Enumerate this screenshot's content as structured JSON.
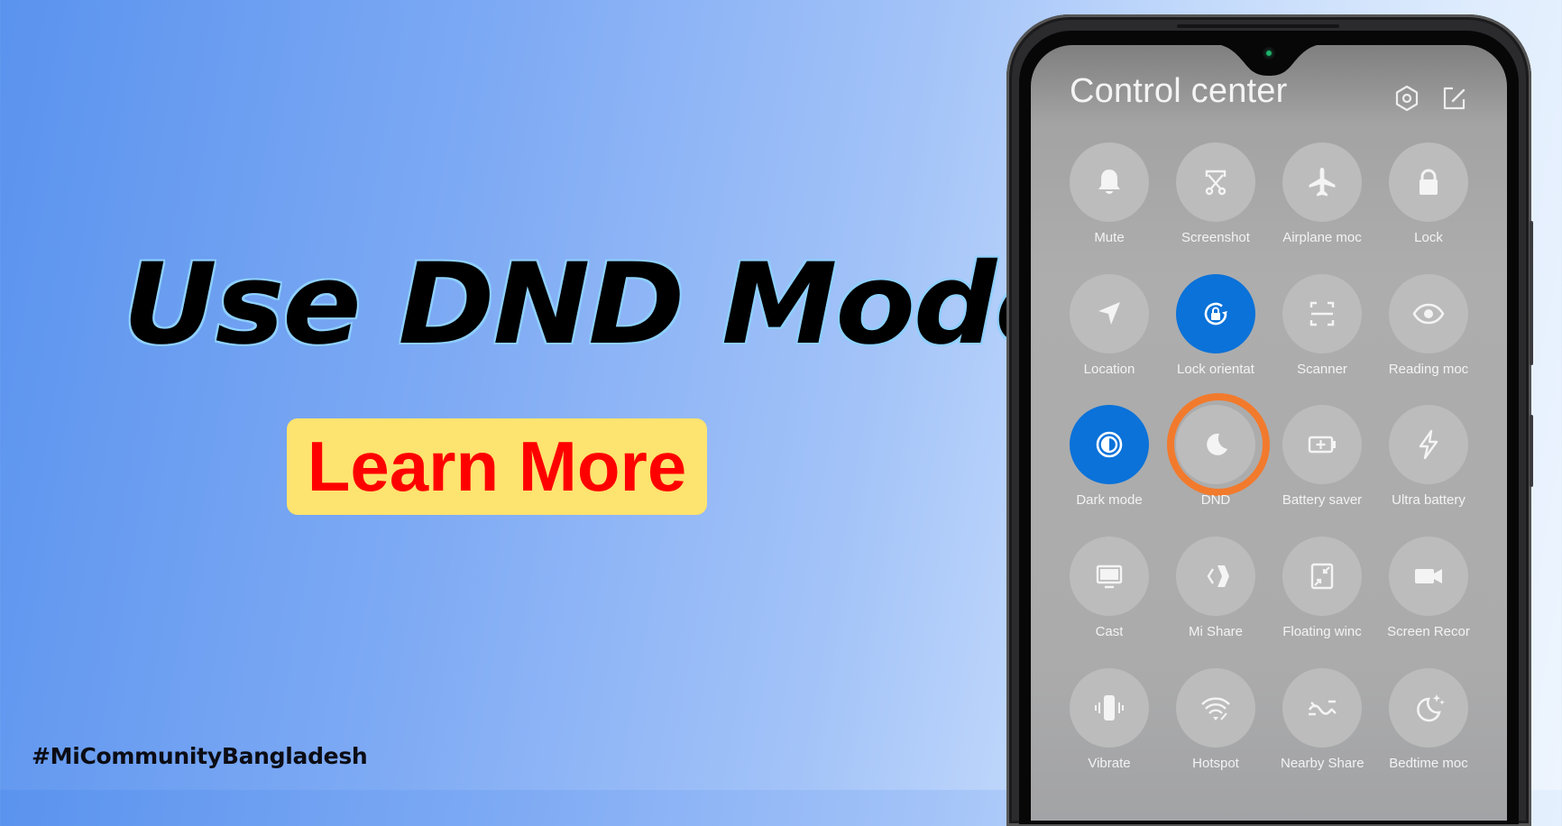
{
  "headline": "Use DND Mode",
  "cta_label": "Learn More",
  "hashtag": "#MiCommunityBangladesh",
  "colors": {
    "headline_text": "#000000",
    "headline_outline": "#8fd0ff",
    "cta_background": "#fde36f",
    "cta_text": "#ff0000",
    "tile_active": "#0a72d9",
    "highlight_ring": "#f27a2c"
  },
  "phone": {
    "control_center": {
      "title": "Control center",
      "header_icons": [
        {
          "name": "settings-icon"
        },
        {
          "name": "edit-icon"
        }
      ],
      "tiles": [
        {
          "label": "Mute",
          "icon": "bell-icon",
          "active": false
        },
        {
          "label": "Screenshot",
          "icon": "screenshot-scissors-icon",
          "active": false
        },
        {
          "label": "Airplane mode",
          "label_visible": "Airplane moc",
          "icon": "airplane-icon",
          "active": false
        },
        {
          "label": "Lock",
          "icon": "lock-icon",
          "active": false
        },
        {
          "label": "Location",
          "icon": "location-arrow-icon",
          "active": false
        },
        {
          "label": "Lock orientation",
          "label_visible": "Lock orientat",
          "icon": "rotation-lock-icon",
          "active": true
        },
        {
          "label": "Scanner",
          "icon": "scanner-icon",
          "active": false
        },
        {
          "label": "Reading mode",
          "label_visible": "Reading moc",
          "icon": "eye-icon",
          "active": false
        },
        {
          "label": "Dark mode",
          "icon": "dark-mode-icon",
          "active": true
        },
        {
          "label": "DND",
          "icon": "moon-icon",
          "active": false,
          "highlighted": true
        },
        {
          "label": "Battery saver",
          "label_visible": "Battery saver",
          "icon": "battery-icon",
          "active": false
        },
        {
          "label": "Ultra battery",
          "icon": "lightning-icon",
          "active": false
        },
        {
          "label": "Cast",
          "icon": "monitor-icon",
          "active": false
        },
        {
          "label": "Mi Share",
          "icon": "mi-share-icon",
          "active": false
        },
        {
          "label": "Floating window",
          "label_visible": "Floating winc",
          "icon": "floating-window-icon",
          "active": false
        },
        {
          "label": "Screen Recorder",
          "label_visible": "Screen Recor",
          "icon": "video-camera-icon",
          "active": false
        },
        {
          "label": "Vibrate",
          "icon": "vibrate-icon",
          "active": false
        },
        {
          "label": "Hotspot",
          "icon": "hotspot-icon",
          "active": false
        },
        {
          "label": "Nearby Share",
          "label_visible": "Nearby Share",
          "icon": "nearby-share-icon",
          "active": false
        },
        {
          "label": "Bedtime mode",
          "label_visible": "Bedtime moc",
          "icon": "bedtime-moon-icon",
          "active": false
        }
      ]
    }
  }
}
